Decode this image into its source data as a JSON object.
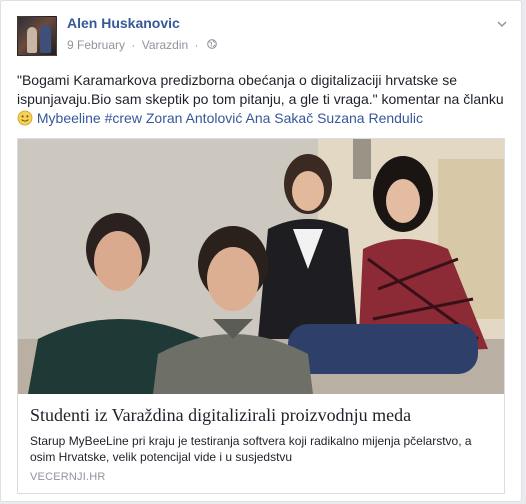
{
  "post": {
    "author": "Alen Huskanovic",
    "date": "9 February",
    "separator": "·",
    "location": "Varazdin",
    "privacy_icon": "globe-icon",
    "menu_icon": "chevron-down-icon",
    "text_part1": "\"Bogami Karamarkova predizborna obećanja o digitalizaciji hrvatske se ispunjavaju.Bio sam skeptik po tom pitanju, a gle ti vraga.\" komentar na članku",
    "emoji_icon": "smiley-icon",
    "tags": [
      "Mybeeline",
      "#crew",
      "Zoran Antolović",
      "Ana Sakač",
      "Suzana Rendulic"
    ]
  },
  "link": {
    "title": "Studenti iz Varaždina digitalizirali proizvodnju meda",
    "description": "Starup MyBeeLine pri kraju je testiranja softvera koji radikalno mijenja pčelarstvo, a osim Hrvatske, velik potencijal vide i u susjedstvu",
    "domain": "VECERNJI.HR"
  },
  "colors": {
    "link_blue": "#365899",
    "meta_grey": "#90949c",
    "text": "#1d2129"
  }
}
